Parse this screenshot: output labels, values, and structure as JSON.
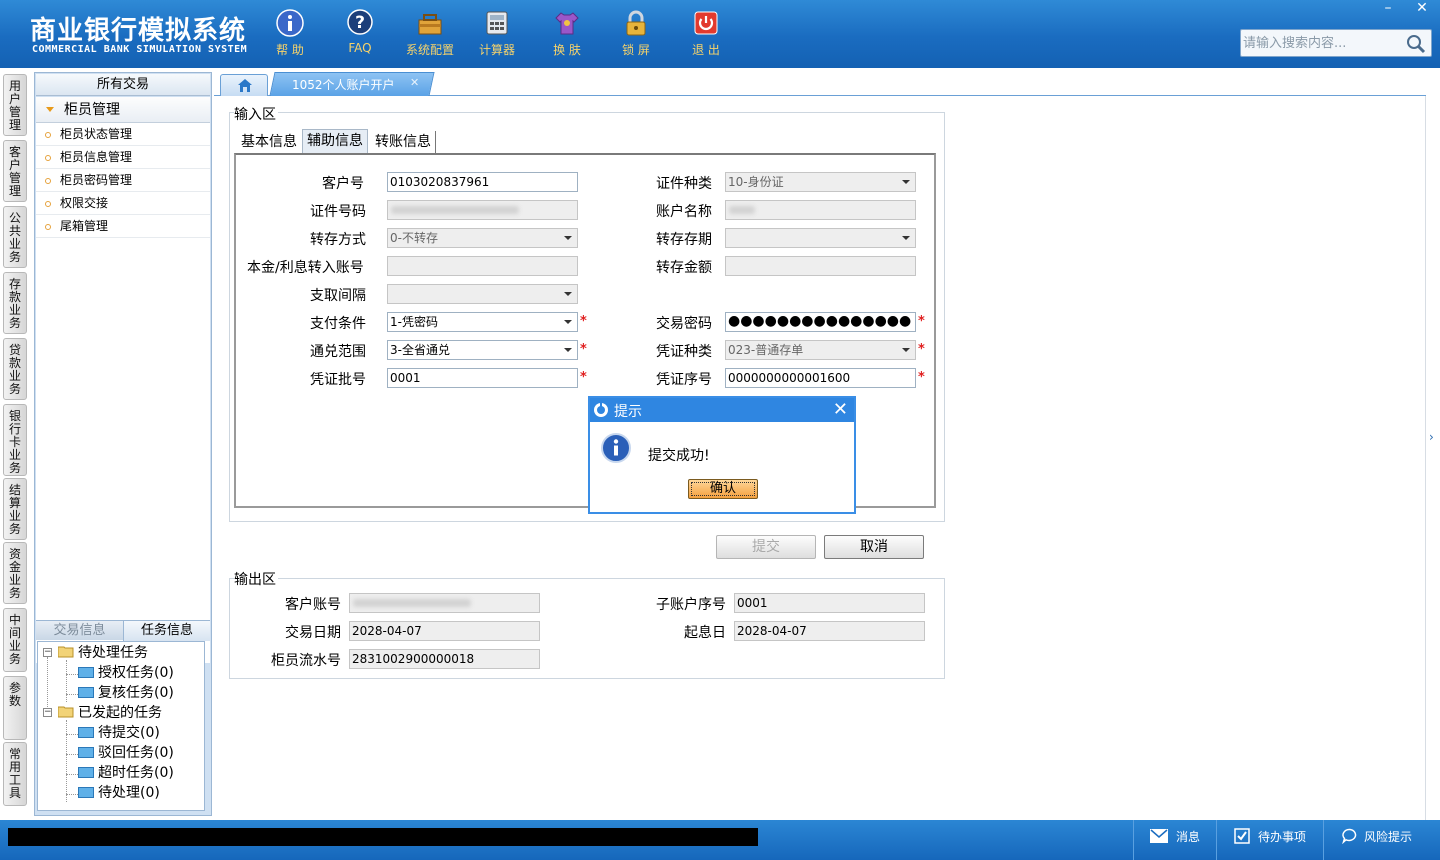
{
  "app": {
    "title": "商业银行模拟系统",
    "subtitle": "COMMERCIAL BANK SIMULATION SYSTEM",
    "colors": {
      "header": "#1a6cc0",
      "toolbar_label": "#f6d36b",
      "accent": "#2f86e1",
      "required": "#e02020"
    }
  },
  "toolbar": {
    "items": [
      {
        "label": "帮 助",
        "icon": "info-icon"
      },
      {
        "label": "FAQ",
        "icon": "question-icon"
      },
      {
        "label": "系统配置",
        "icon": "toolbox-icon"
      },
      {
        "label": "计算器",
        "icon": "calculator-icon"
      },
      {
        "label": "换 肤",
        "icon": "shirt-icon"
      },
      {
        "label": "锁 屏",
        "icon": "lock-icon"
      },
      {
        "label": "退 出",
        "icon": "power-icon"
      }
    ]
  },
  "window": {
    "minimize": "–",
    "close": "✕"
  },
  "search": {
    "placeholder": "请输入搜索内容..."
  },
  "side_tabs": [
    "用户管理",
    "客户管理",
    "公共业务",
    "存款业务",
    "贷款业务",
    "银行卡业务",
    "结算业务",
    "资金业务",
    "中间业务",
    "参数",
    "常用工具"
  ],
  "left_panel": {
    "header": "所有交易",
    "group": "柜员管理",
    "items": [
      "柜员状态管理",
      "柜员信息管理",
      "柜员密码管理",
      "权限交接",
      "尾箱管理"
    ],
    "task_tabs": [
      "交易信息",
      "任务信息"
    ],
    "tree": {
      "pending": "待处理任务",
      "authorize": "授权任务(0)",
      "review": "复核任务(0)",
      "initiated": "已发起的任务",
      "to_submit": "待提交(0)",
      "rejected": "驳回任务(0)",
      "timeout": "超时任务(0)",
      "to_process": "待处理(0)"
    }
  },
  "content_tabs": {
    "active": "1052个人账户开户",
    "close": "✕"
  },
  "input_section": {
    "title": "输入区",
    "tabs": [
      "基本信息",
      "辅助信息",
      "转账信息"
    ],
    "fields": {
      "customer_no_label": "客户号",
      "customer_no": "0103020837961",
      "id_type_label": "证件种类",
      "id_type": "10-身份证",
      "id_no_label": "证件号码",
      "account_name_label": "账户名称",
      "rollover_mode_label": "转存方式",
      "rollover_mode": "0-不转存",
      "rollover_term_label": "转存存期",
      "transfer_account_label": "本金/利息转入账号",
      "rollover_amount_label": "转存金额",
      "withdraw_interval_label": "支取间隔",
      "pay_condition_label": "支付条件",
      "pay_condition": "1-凭密码",
      "tx_password_label": "交易密码",
      "tx_password": "●●●●●●●●●●●●●●●",
      "exchange_scope_label": "通兑范围",
      "exchange_scope": "3-全省通兑",
      "voucher_type_label": "凭证种类",
      "voucher_type": "023-普通存单",
      "voucher_batch_label": "凭证批号",
      "voucher_batch": "0001",
      "voucher_serial_label": "凭证序号",
      "voucher_serial": "0000000000001600",
      "required_mark": "*"
    }
  },
  "actions": {
    "submit": "提交",
    "cancel": "取消"
  },
  "output_section": {
    "title": "输出区",
    "customer_account_label": "客户账号",
    "sub_account_label": "子账户序号",
    "sub_account": "0001",
    "tx_date_label": "交易日期",
    "tx_date": "2028-04-07",
    "value_date_label": "起息日",
    "value_date": "2028-04-07",
    "teller_serial_label": "柜员流水号",
    "teller_serial": "2831002900000018"
  },
  "dialog": {
    "title": "提示",
    "message": "提交成功!",
    "ok": "确认",
    "close": "✕"
  },
  "statusbar": {
    "messages": "消息",
    "todo": "待办事项",
    "risk": "风险提示"
  }
}
